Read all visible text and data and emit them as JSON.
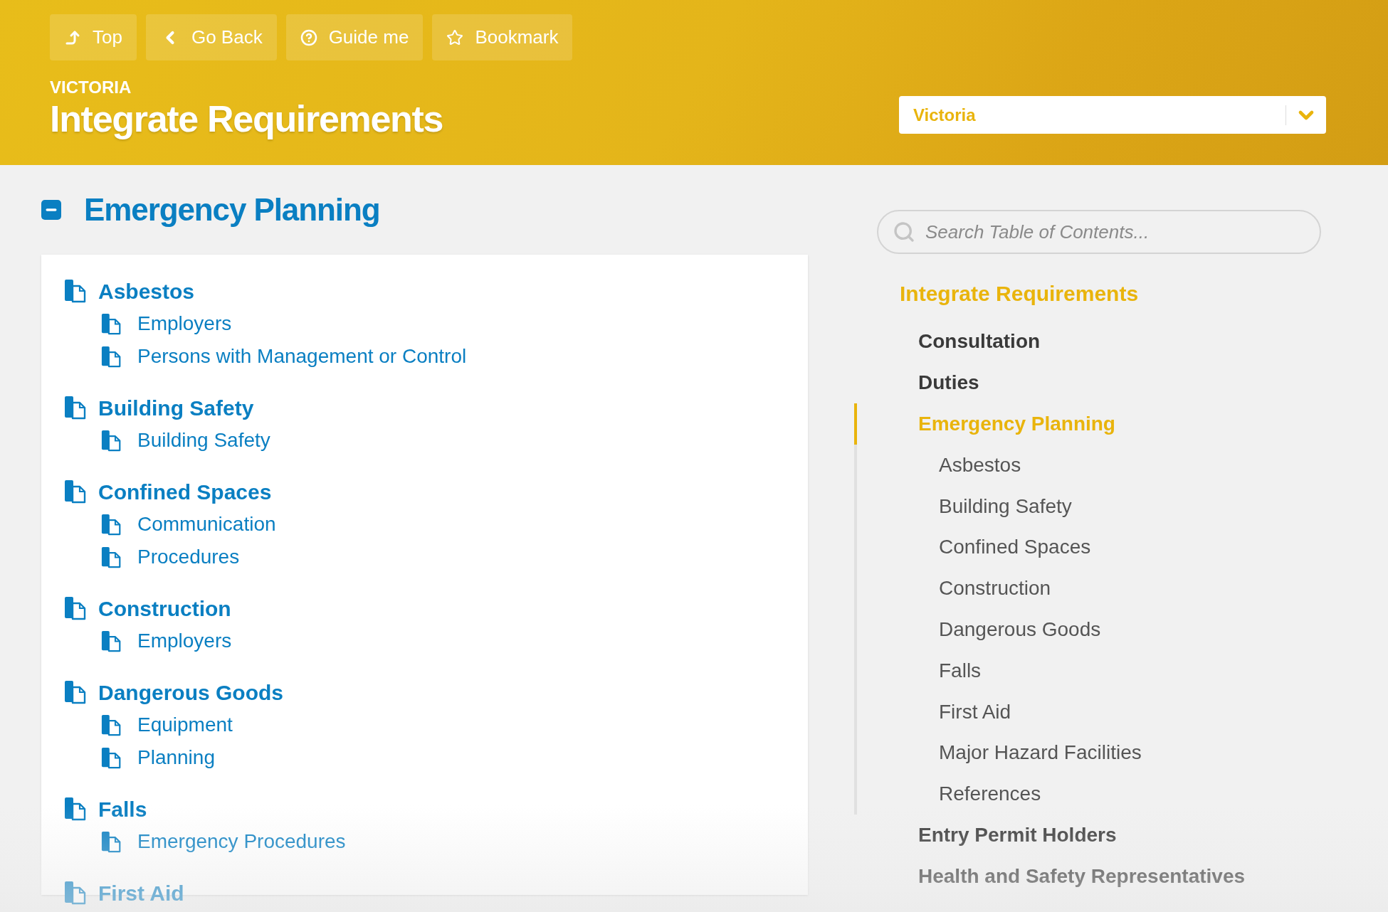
{
  "toolbar": [
    {
      "kind": "top",
      "label": "Top"
    },
    {
      "kind": "back",
      "label": "Go Back"
    },
    {
      "kind": "guide",
      "label": "Guide me"
    },
    {
      "kind": "bookmark",
      "label": "Bookmark"
    }
  ],
  "header": {
    "eyebrow": "VICTORIA",
    "title": "Integrate Requirements",
    "state_select": {
      "value": "Victoria"
    }
  },
  "section": {
    "title": "Emergency Planning",
    "expanded": true,
    "items": [
      {
        "title": "Asbestos",
        "children": [
          "Employers",
          "Persons with Management or Control"
        ]
      },
      {
        "title": "Building Safety",
        "children": [
          "Building Safety"
        ]
      },
      {
        "title": "Confined Spaces",
        "children": [
          "Communication",
          "Procedures"
        ]
      },
      {
        "title": "Construction",
        "children": [
          "Employers"
        ]
      },
      {
        "title": "Dangerous Goods",
        "children": [
          "Equipment",
          "Planning"
        ]
      },
      {
        "title": "Falls",
        "children": [
          "Emergency Procedures"
        ]
      },
      {
        "title": "First Aid"
      }
    ]
  },
  "toc": {
    "search": {
      "placeholder": "Search Table of Contents..."
    },
    "title": "Integrate Requirements",
    "items": [
      {
        "label": "Consultation",
        "selected": false
      },
      {
        "label": "Duties",
        "selected": false
      },
      {
        "label": "Emergency Planning",
        "selected": true,
        "children": [
          {
            "label": "Asbestos",
            "selected": false
          },
          {
            "label": "Building Safety",
            "selected": false
          },
          {
            "label": "Confined Spaces",
            "selected": false
          },
          {
            "label": "Construction",
            "selected": false
          },
          {
            "label": "Dangerous Goods",
            "selected": false
          },
          {
            "label": "Falls",
            "selected": false
          },
          {
            "label": "First Aid",
            "selected": false
          },
          {
            "label": "Major Hazard Facilities",
            "selected": false
          },
          {
            "label": "References",
            "selected": false
          }
        ]
      },
      {
        "label": "Entry Permit Holders",
        "selected": false
      },
      {
        "label": "Health and Safety Representatives",
        "selected": false
      }
    ]
  }
}
